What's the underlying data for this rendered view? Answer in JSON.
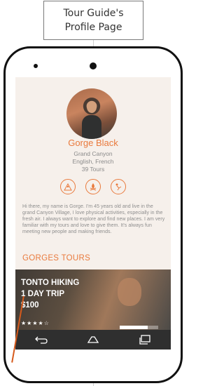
{
  "caption": {
    "line1": "Tour Guide's",
    "line2": "Profile Page"
  },
  "profile": {
    "name": "Gorge Black",
    "location": "Grand Canyon",
    "languages": "English, French",
    "tours": "39 Tours",
    "bio": "Hi there, my name is Gorge. I'm 45 years old and live in the grand Canyon Village, I love physical activities, especially in the fresh air. I always want to explore and find new places. I am very familiar with my tours and love to give them. It's always fun meeting new people and making friends."
  },
  "activity_icons": [
    "hiking-icon",
    "campfire-icon",
    "climbing-icon"
  ],
  "section_title": "GORGES TOURS",
  "tour": {
    "title_line1": "TONTO HIKING",
    "title_line2": "1 DAY TRIP",
    "price": "$100",
    "stars_text": "★★★★☆",
    "progress": 0.72
  },
  "nav": [
    "back-icon",
    "home-icon",
    "recent-apps-icon"
  ],
  "colors": {
    "accent": "#e97a3d",
    "navbar": "#2f2f2f",
    "screen_bg": "#f6f0eb"
  }
}
